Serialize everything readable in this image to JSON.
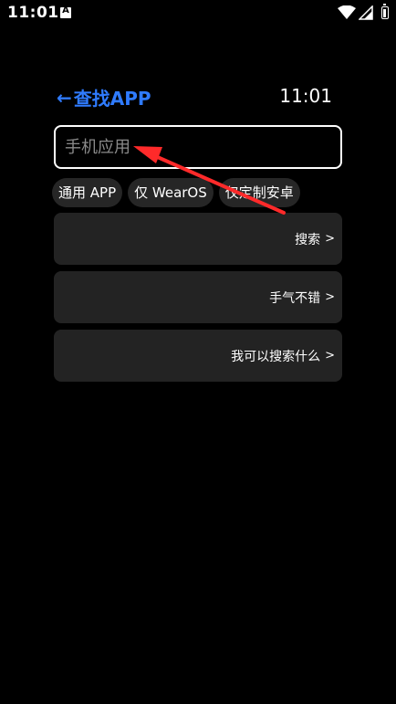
{
  "status_bar": {
    "time": "11:01",
    "notification_icon": "a-icon",
    "notification_letter": "A",
    "wifi_icon": "wifi-icon",
    "signal_icon": "signal-icon",
    "battery_icon": "battery-icon"
  },
  "header": {
    "back_arrow": "←",
    "title": "查找APP",
    "clock": "11:01"
  },
  "search": {
    "placeholder": "手机应用",
    "value": ""
  },
  "chips": [
    "通用 APP",
    "仅 WearOS",
    "仅定制安卓"
  ],
  "cards": [
    {
      "label": "搜索",
      "chevron": ">"
    },
    {
      "label": "手气不错",
      "chevron": ">"
    },
    {
      "label": "我可以搜索什么",
      "chevron": ">"
    }
  ],
  "colors": {
    "accent": "#2f7bff",
    "background": "#000000",
    "card": "#232323",
    "chip": "#262626",
    "annotation_arrow": "#ff2a2a"
  }
}
